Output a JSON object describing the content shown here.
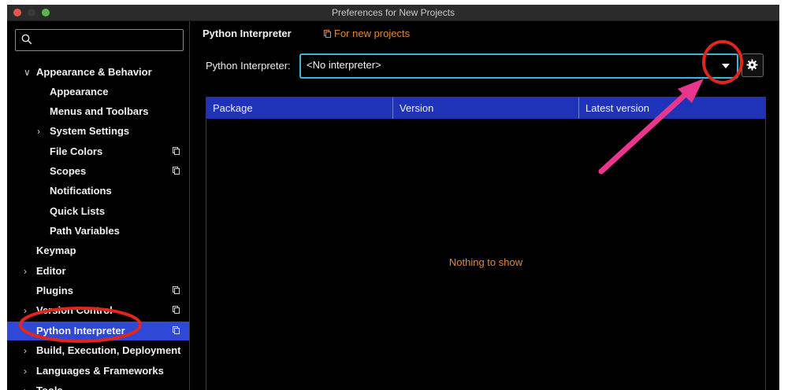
{
  "window": {
    "title": "Preferences for New Projects"
  },
  "sidebar": {
    "search_placeholder": "",
    "items": [
      {
        "label": "Appearance & Behavior",
        "expanded": true
      },
      {
        "label": "Appearance"
      },
      {
        "label": "Menus and Toolbars"
      },
      {
        "label": "System Settings",
        "expanded": false
      },
      {
        "label": "File Colors"
      },
      {
        "label": "Scopes"
      },
      {
        "label": "Notifications"
      },
      {
        "label": "Quick Lists"
      },
      {
        "label": "Path Variables"
      },
      {
        "label": "Keymap"
      },
      {
        "label": "Editor",
        "expanded": false
      },
      {
        "label": "Plugins"
      },
      {
        "label": "Version Control",
        "expanded": false
      },
      {
        "label": "Python Interpreter",
        "selected": true
      },
      {
        "label": "Build, Execution, Deployment",
        "expanded": false
      },
      {
        "label": "Languages & Frameworks",
        "expanded": false
      },
      {
        "label": "Tools",
        "expanded": false
      }
    ]
  },
  "main": {
    "title": "Python Interpreter",
    "scope_link": "For new projects",
    "interpreter_label": "Python Interpreter:",
    "interpreter_value": "<No interpreter>",
    "table": {
      "columns": [
        "Package",
        "Version",
        "Latest version"
      ],
      "empty_text": "Nothing to show"
    }
  },
  "colors": {
    "selection": "#2f49d6",
    "table_header": "#1f33b8",
    "focus_border": "#3bb8d8",
    "link": "#e5892c",
    "annotation_circle": "#e0261d",
    "annotation_arrow": "#e8368f"
  },
  "icons": [
    "search-icon",
    "chevron-down-icon",
    "chevron-right-icon",
    "copy-icon",
    "dropdown-caret-icon",
    "gear-icon"
  ]
}
